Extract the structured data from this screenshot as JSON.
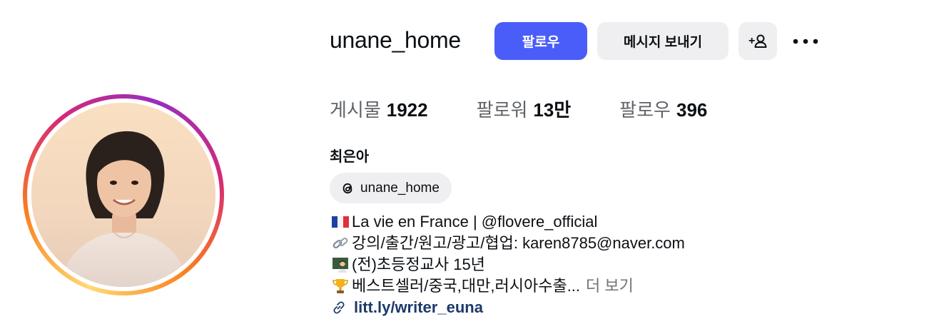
{
  "profile": {
    "username": "unane_home",
    "full_name": "최은아",
    "follow_label": "팔로우",
    "message_label": "메시지 보내기",
    "add_user_icon": "add-user-icon",
    "more_icon": "more-options-icon"
  },
  "stats": {
    "posts_label": "게시물",
    "posts_value": "1922",
    "followers_label": "팔로워",
    "followers_value": "13만",
    "following_label": "팔로우",
    "following_value": "396"
  },
  "threads": {
    "handle": "unane_home",
    "icon": "threads-icon"
  },
  "bio": {
    "lines": [
      {
        "emoji": "france-flag",
        "text": "La vie en France | @flovere_official"
      },
      {
        "emoji": "link-emoji",
        "text": "강의/출간/원고/광고/협업: karen8785@naver.com"
      },
      {
        "emoji": "teacher-emoji",
        "text": "(전)초등정교사 15년"
      },
      {
        "emoji": "trophy-emoji",
        "text": "베스트셀러/중국,대만,러시아수출..."
      }
    ],
    "more_label": "더 보기",
    "link": "litt.ly/writer_euna"
  },
  "colors": {
    "follow_button": "#4a5df9",
    "secondary_button": "#efeff1",
    "link_text": "#1c3a6b",
    "muted_text": "#737373"
  }
}
